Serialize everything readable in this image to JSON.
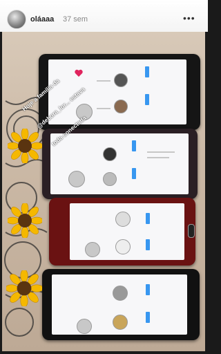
{
  "story": {
    "username": "oláaaa",
    "age": "37 sem",
    "menu_icon": "more-icon",
    "progress": 1.0
  },
  "caption": {
    "line1": "Hoje a família da",
    "line2": "@debora_lor... estava",
    "line3": "toda conectada"
  }
}
